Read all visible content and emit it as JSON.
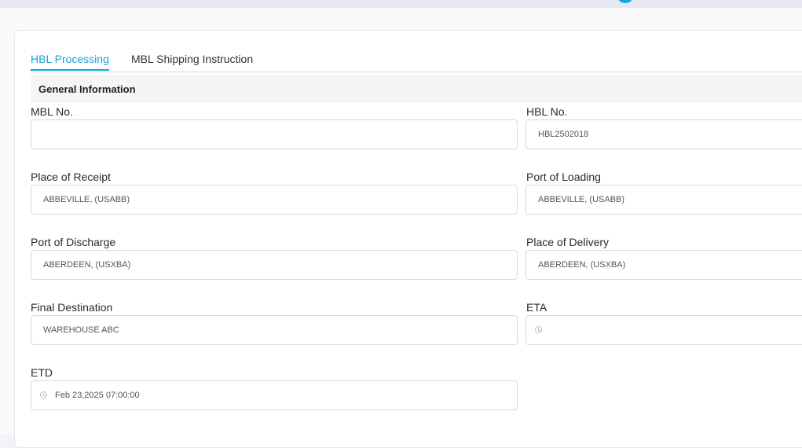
{
  "tabs": [
    {
      "label": "HBL Processing",
      "active": true
    },
    {
      "label": "MBL Shipping Instruction",
      "active": false
    }
  ],
  "section": {
    "title": "General Information"
  },
  "fields": {
    "mbl_no": {
      "label": "MBL No.",
      "value": ""
    },
    "hbl_no": {
      "label": "HBL No.",
      "value": "HBL2502018"
    },
    "place_of_receipt": {
      "label": "Place of Receipt",
      "value": "ABBEVILLE,  (USABB)"
    },
    "port_of_loading": {
      "label": "Port of Loading",
      "value": "ABBEVILLE,  (USABB)"
    },
    "port_of_discharge": {
      "label": "Port of Discharge",
      "value": "ABERDEEN,  (USXBA)"
    },
    "place_of_delivery": {
      "label": "Place of Delivery",
      "value": "ABERDEEN,  (USXBA)"
    },
    "final_destination": {
      "label": "Final Destination",
      "value": "WAREHOUSE ABC"
    },
    "eta": {
      "label": "ETA",
      "value": ""
    },
    "etd": {
      "label": "ETD",
      "value": "Feb 23,2025 07:00:00"
    }
  },
  "colors": {
    "accent": "#17a2d6",
    "notification_dot": "#1aa3e8"
  },
  "icons": {
    "datetime": "clock-icon"
  }
}
